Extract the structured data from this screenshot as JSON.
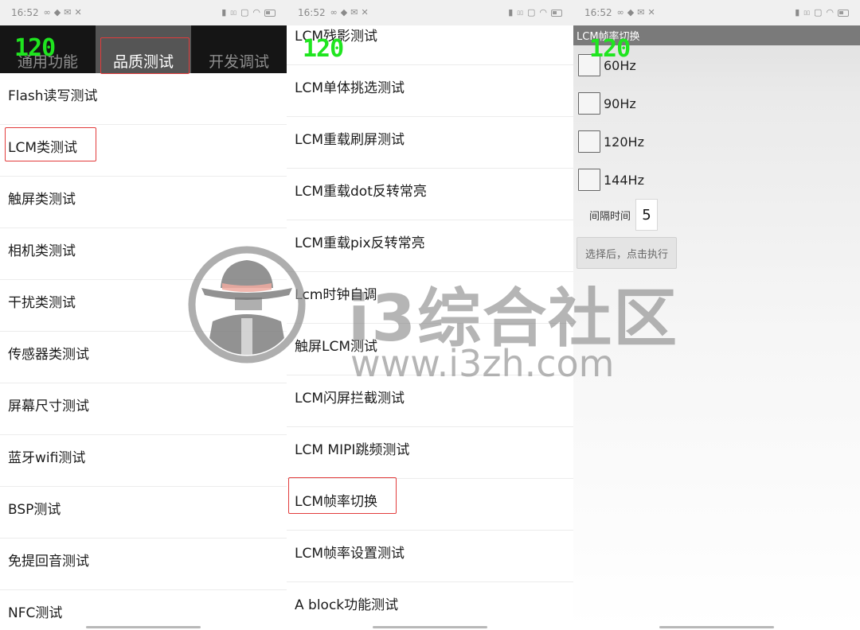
{
  "status_bar": {
    "time": "16:52"
  },
  "fps_overlay": "120",
  "panel1": {
    "tabs": [
      {
        "label": "通用功能"
      },
      {
        "label": "品质测试"
      },
      {
        "label": "开发调试"
      }
    ],
    "items": [
      "Flash读写测试",
      "LCM类测试",
      "触屏类测试",
      "相机类测试",
      "干扰类测试",
      "传感器类测试",
      "屏幕尺寸测试",
      "蓝牙wifi测试",
      "BSP测试",
      "免提回音测试",
      "NFC测试"
    ]
  },
  "panel2": {
    "items": [
      "LCM残影测试",
      "LCM单体挑选测试",
      "LCM重载刷屏测试",
      "LCM重载dot反转常亮",
      "LCM重载pix反转常亮",
      "Lcm时钟自调",
      "触屏LCM测试",
      "LCM闪屏拦截测试",
      "LCM MIPI跳频测试",
      "LCM帧率切换",
      "LCM帧率设置测试",
      "A block功能测试"
    ]
  },
  "panel3": {
    "title": "LCM帧率切换",
    "options": [
      "60Hz",
      "90Hz",
      "120Hz",
      "144Hz"
    ],
    "interval_label": "间隔时间",
    "interval_value": "5",
    "execute_label": "选择后，点击执行"
  },
  "watermark": {
    "name": "i3综合社区",
    "url": "www.i3zh.com"
  }
}
